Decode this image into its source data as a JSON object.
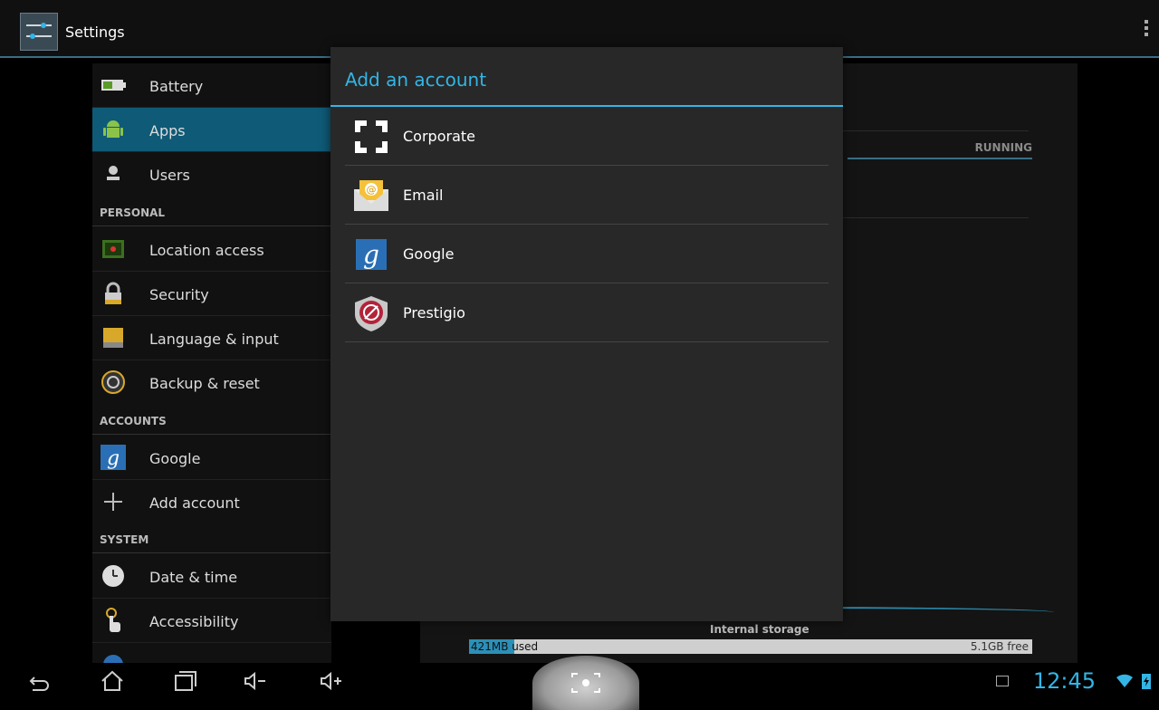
{
  "app": {
    "title": "Settings"
  },
  "sidebar": {
    "items": [
      {
        "label": "Battery"
      },
      {
        "label": "Apps"
      },
      {
        "label": "Users"
      }
    ],
    "sections": [
      {
        "header": "PERSONAL",
        "items": [
          {
            "label": "Location access"
          },
          {
            "label": "Security"
          },
          {
            "label": "Language & input"
          },
          {
            "label": "Backup & reset"
          }
        ]
      },
      {
        "header": "ACCOUNTS",
        "items": [
          {
            "label": "Google"
          },
          {
            "label": "Add account"
          }
        ]
      },
      {
        "header": "SYSTEM",
        "items": [
          {
            "label": "Date & time"
          },
          {
            "label": "Accessibility"
          }
        ]
      }
    ]
  },
  "main": {
    "tab_running": "RUNNING",
    "storage": {
      "label": "Internal storage",
      "used": "421MB used",
      "free": "5.1GB free",
      "used_fraction": 0.08
    }
  },
  "dialog": {
    "title": "Add an account",
    "options": [
      {
        "label": "Corporate",
        "icon": "corporate-icon"
      },
      {
        "label": "Email",
        "icon": "email-icon"
      },
      {
        "label": "Google",
        "icon": "google-icon"
      },
      {
        "label": "Prestigio",
        "icon": "prestigio-icon"
      }
    ]
  },
  "statusbar": {
    "time": "12:45"
  },
  "colors": {
    "accent": "#33b5e5",
    "selected": "#0f5a76"
  }
}
